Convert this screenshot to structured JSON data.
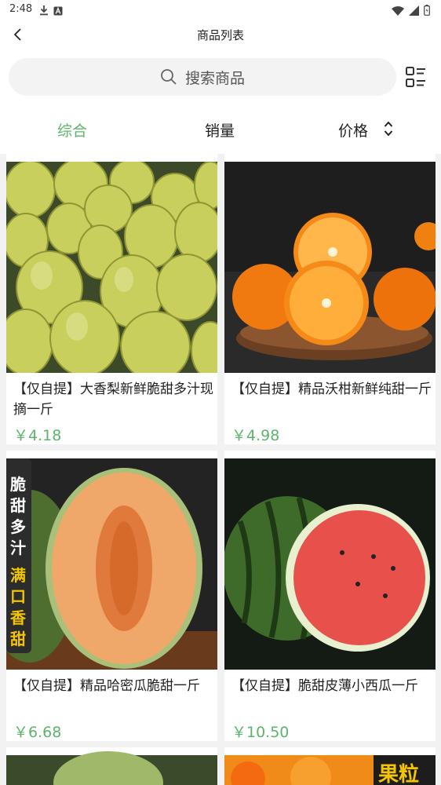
{
  "status_bar": {
    "time": "2:48",
    "icons": [
      "download-icon",
      "notification-a-icon",
      "wifi-icon",
      "signal-icon",
      "battery-icon"
    ]
  },
  "nav": {
    "title": "商品列表",
    "back_icon": "chevron-left-icon"
  },
  "search": {
    "placeholder": "搜索商品",
    "icon": "search-icon",
    "layout_toggle_icon": "list-layout-icon"
  },
  "sort_tabs": [
    {
      "label": "综合",
      "active": true
    },
    {
      "label": "销量",
      "active": false
    },
    {
      "label": "价格",
      "active": false,
      "icon": "sort-updown-icon"
    }
  ],
  "products": [
    {
      "title": "【仅自提】大香梨新鲜脆甜多汁现摘一斤",
      "price": "￥4.18",
      "image": "pears"
    },
    {
      "title": "【仅自提】精品沃柑新鲜纯甜一斤",
      "price": "￥4.98",
      "image": "mandarins"
    },
    {
      "title": "【仅自提】精品哈密瓜脆甜一斤",
      "price": "￥6.68",
      "image": "hami-melon",
      "image_text": {
        "top": "脆甜多汁",
        "bottom": "满口香甜"
      }
    },
    {
      "title": "【仅自提】脆甜皮薄小西瓜一斤",
      "price": "￥10.50",
      "image": "watermelon"
    }
  ],
  "peek_banner_text": "果粒",
  "colors": {
    "accent": "#5cb56a",
    "background": "#f2f2f2",
    "card": "#ffffff"
  }
}
